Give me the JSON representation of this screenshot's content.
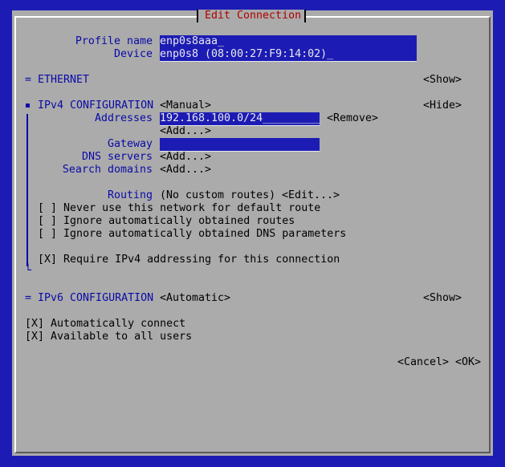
{
  "dialog": {
    "title": "Edit Connection"
  },
  "profile": {
    "name_label": "Profile name",
    "name_value": "enp0s8aaa",
    "name_cursor": "_",
    "device_label": "Device",
    "device_value": "enp0s8 (08:00:27:F9:14:02)",
    "device_cursor": "_"
  },
  "ethernet": {
    "label": "= ETHERNET",
    "toggle": "<Show>"
  },
  "ipv4": {
    "label": "IPv4 CONFIGURATION",
    "mode": "<Manual>",
    "toggle": "<Hide>",
    "addresses_label": "Addresses",
    "address_value": "192.168.100.0/24",
    "address_cursor": "_________",
    "remove_button": "<Remove>",
    "add_address_button": "<Add...>",
    "gateway_label": "Gateway",
    "gateway_value": "",
    "dns_label": "DNS servers",
    "dns_add": "<Add...>",
    "search_label": "Search domains",
    "search_add": "<Add...>",
    "routing_label": "Routing",
    "routing_value": "(No custom routes)",
    "routing_edit": "<Edit...>",
    "options": [
      {
        "checkbox": "[ ]",
        "label": "Never use this network for default route"
      },
      {
        "checkbox": "[ ]",
        "label": "Ignore automatically obtained routes"
      },
      {
        "checkbox": "[ ]",
        "label": "Ignore automatically obtained DNS parameters"
      }
    ],
    "require": {
      "checkbox": "[X]",
      "label": "Require IPv4 addressing for this connection"
    },
    "closing_bracket": "└"
  },
  "ipv6": {
    "label": "= IPv6 CONFIGURATION",
    "mode": "<Automatic>",
    "toggle": "<Show>"
  },
  "general": [
    {
      "checkbox": "[X]",
      "label": "Automatically connect"
    },
    {
      "checkbox": "[X]",
      "label": "Available to all users"
    }
  ],
  "buttons": {
    "cancel": "<Cancel>",
    "ok": "<OK>"
  },
  "colors": {
    "screen_bg": "#1c1cb4",
    "dialog_bg": "#ababab",
    "title_text": "#b00000",
    "label_text": "#0a0aa8",
    "field_bg": "#1c1cb4",
    "field_text": "#e8e8e8"
  }
}
